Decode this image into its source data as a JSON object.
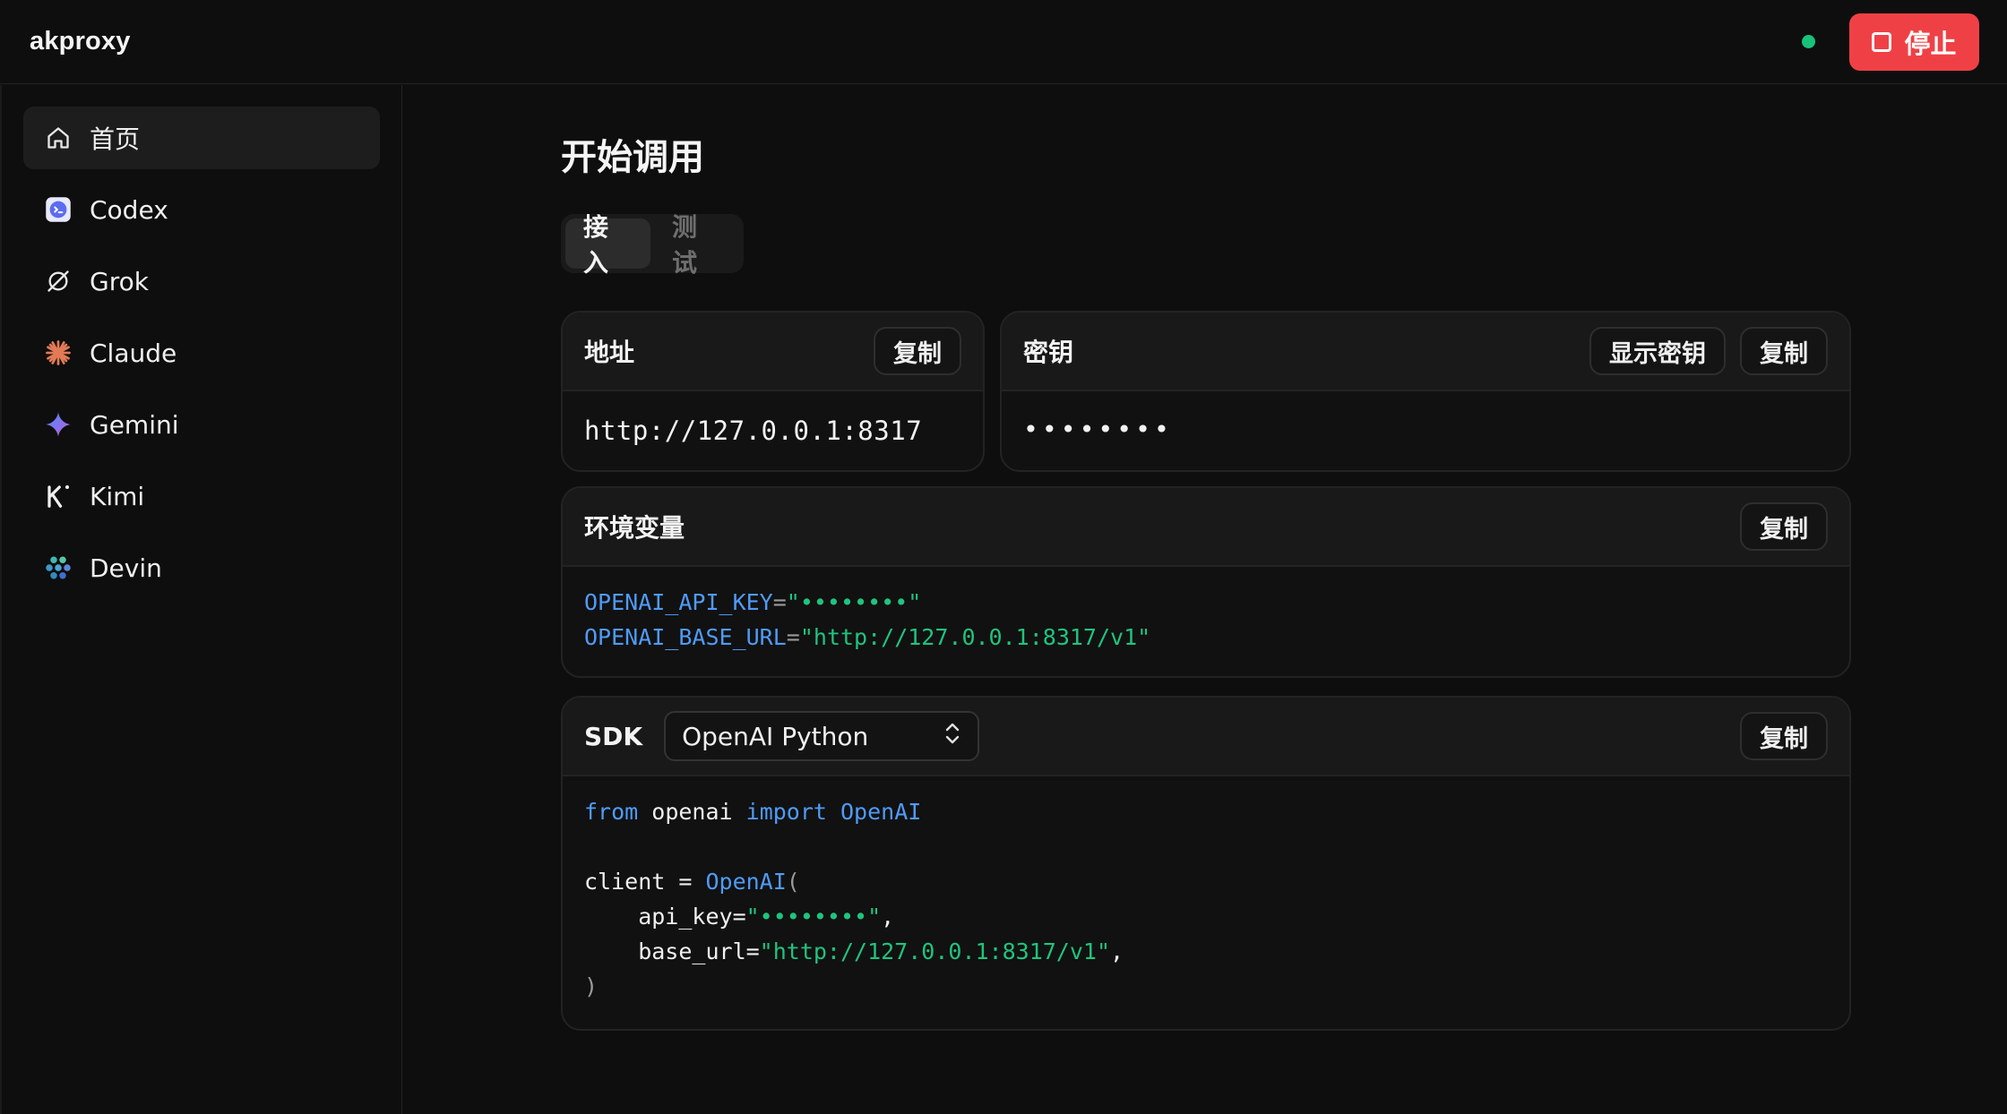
{
  "app": {
    "title": "akproxy"
  },
  "topbar": {
    "stop_label": "停止",
    "status_color": "#18c27a",
    "stop_color": "#ef4145"
  },
  "sidebar": {
    "items": [
      {
        "label": "首页",
        "icon": "home-icon",
        "active": true
      },
      {
        "label": "Codex",
        "icon": "codex-icon"
      },
      {
        "label": "Grok",
        "icon": "grok-icon"
      },
      {
        "label": "Claude",
        "icon": "claude-icon"
      },
      {
        "label": "Gemini",
        "icon": "gemini-icon"
      },
      {
        "label": "Kimi",
        "icon": "kimi-icon"
      },
      {
        "label": "Devin",
        "icon": "devin-icon"
      }
    ]
  },
  "main": {
    "title": "开始调用",
    "tabs": [
      {
        "label": "接入",
        "active": true
      },
      {
        "label": "测试"
      }
    ],
    "address": {
      "title": "地址",
      "copy_label": "复制",
      "value": "http://127.0.0.1:8317"
    },
    "key": {
      "title": "密钥",
      "show_label": "显示密钥",
      "copy_label": "复制",
      "value": "••••••••"
    },
    "env": {
      "title": "环境变量",
      "copy_label": "复制",
      "lines": [
        {
          "name": "OPENAI_API_KEY",
          "eq": "=",
          "value": "\"••••••••\""
        },
        {
          "name": "OPENAI_BASE_URL",
          "eq": "=",
          "value": "\"http://127.0.0.1:8317/v1\""
        }
      ]
    },
    "sdk": {
      "title": "SDK",
      "selected": "OpenAI Python",
      "copy_label": "复制",
      "code": {
        "from": "from",
        "module": " openai ",
        "import": "import",
        "cls": " OpenAI",
        "client": "client = ",
        "ctor": "OpenAI",
        "paren_open": "(",
        "api_key_name": "    api_key=",
        "api_key_val": "\"••••••••\"",
        "comma": ",",
        "base_url_name": "    base_url=",
        "base_url_val": "\"http://127.0.0.1:8317/v1\"",
        "paren_close": ")"
      }
    }
  }
}
